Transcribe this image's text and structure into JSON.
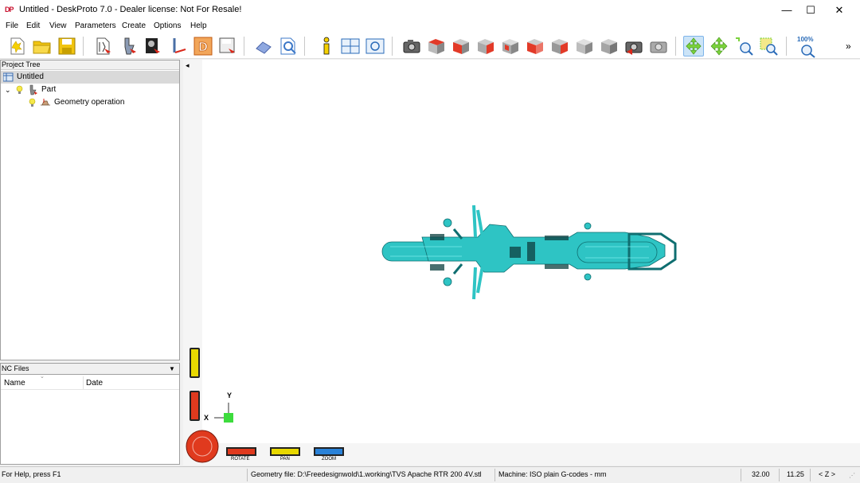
{
  "window": {
    "title": "Untitled - DeskProto 7.0 - Dealer license: Not For Resale!",
    "app_icon": "DP",
    "minimize": "—",
    "maximize": "☐",
    "close": "✕"
  },
  "menu": [
    "File",
    "Edit",
    "View",
    "Parameters",
    "Create",
    "Options",
    "Help"
  ],
  "toolbar": {
    "zoom_100_label": "100%",
    "overflow": "»"
  },
  "project_tree": {
    "header": "Project Tree",
    "root": "Untitled",
    "part": "Part",
    "operation": "Geometry operation"
  },
  "nc_files": {
    "header": "NC Files",
    "columns": [
      "Name",
      "Date"
    ]
  },
  "viewport": {
    "collapse_arrow": "◂",
    "axis_y": "Y",
    "axis_x": "X",
    "controls": [
      "ROTATE",
      "PAN",
      "ZOOM"
    ]
  },
  "statusbar": {
    "help": "For Help, press F1",
    "geometry_file": "Geometry file: D:\\Freedesignwold\\1.working\\TVS Apache RTR 200 4V.stl",
    "machine": "Machine: ISO plain G-codes - mm",
    "val1": "32.00",
    "val2": "11.25",
    "axis": "< Z >"
  },
  "colors": {
    "model": "#2ec4c4",
    "rotate": "#e03a1e",
    "pan": "#e8d800",
    "zoom": "#2a82d8",
    "axis_marker": "#3ddc3d"
  }
}
